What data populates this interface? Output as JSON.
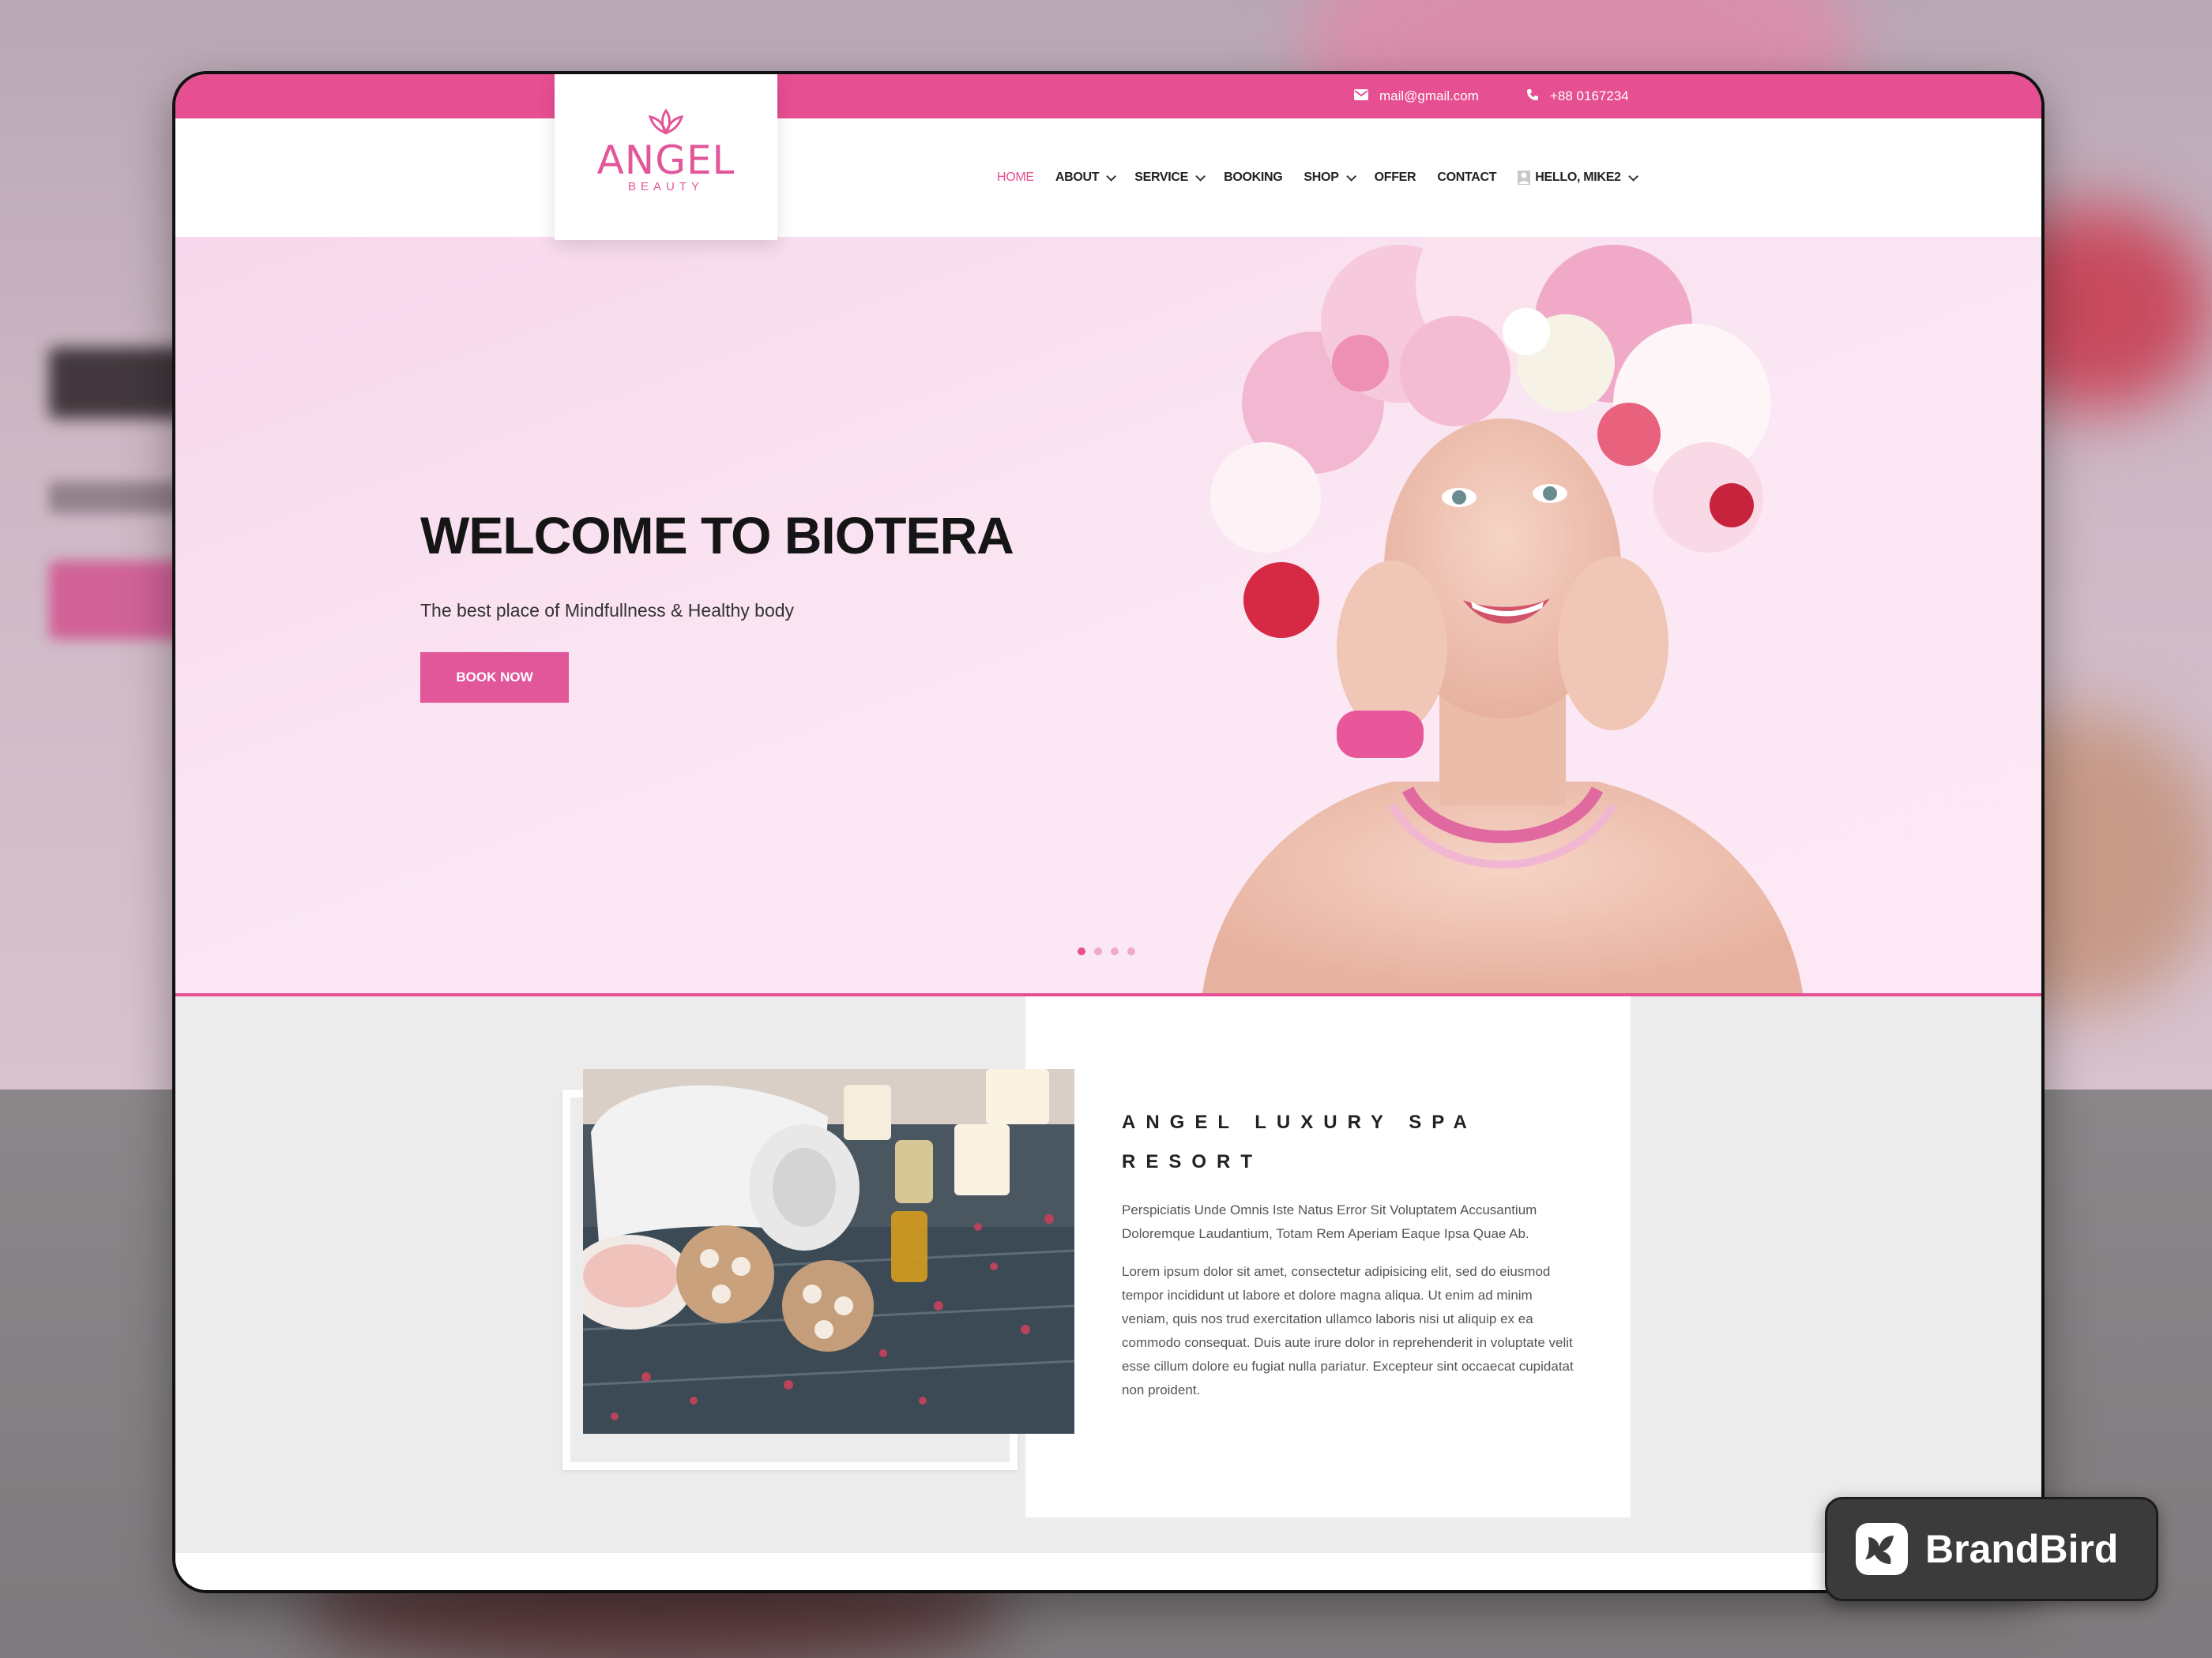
{
  "topbar": {
    "email": "mail@gmail.com",
    "phone": "+88 0167234",
    "accent_color": "#e64f92"
  },
  "logo": {
    "title": "ANGEL",
    "subtitle": "BEAUTY",
    "icon": "lotus-icon"
  },
  "nav": {
    "items": [
      {
        "label": "HOME",
        "active": true
      },
      {
        "label": "ABOUT",
        "dropdown": true
      },
      {
        "label": "SERVICE",
        "dropdown": true
      },
      {
        "label": "BOOKING"
      },
      {
        "label": "SHOP",
        "dropdown": true
      },
      {
        "label": "OFFER"
      },
      {
        "label": "CONTACT"
      },
      {
        "label": "HELLO, MIKE2",
        "dropdown": true,
        "icon": "user-icon"
      }
    ]
  },
  "hero": {
    "title": "WELCOME TO BIOTERA",
    "subtitle": "The best place of Mindfullness & Healthy body",
    "button": "BOOK NOW",
    "slides": 4,
    "active_slide": 1,
    "image": "woman-with-flower-crown-image"
  },
  "about": {
    "title": "ANGEL LUXURY SPA RESORT",
    "intro": "Perspiciatis Unde Omnis Iste Natus Error Sit Voluptatem Accusantium Doloremque Laudantium, Totam Rem Aperiam Eaque Ipsa Quae Ab.",
    "body": "Lorem ipsum dolor sit amet, consectetur adipisicing elit, sed do eiusmod tempor incididunt ut labore et dolore magna aliqua. Ut enim ad minim veniam, quis nos trud exercitation ullamco laboris nisi ut aliquip ex ea commodo consequat. Duis aute irure dolor in reprehenderit in voluptate velit esse cillum dolore eu fugiat nulla pariatur. Excepteur sint occaecat cupidatat non proident.",
    "image": "spa-towel-candles-image"
  },
  "badge": {
    "label": "BrandBird"
  }
}
